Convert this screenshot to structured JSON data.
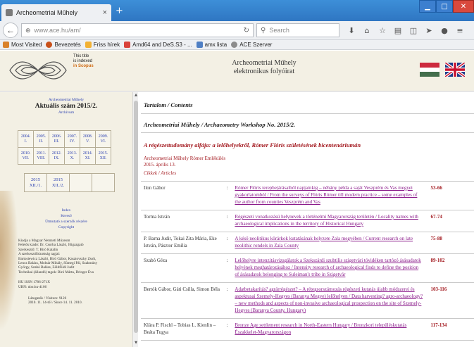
{
  "browser": {
    "tab_title": "Archeometriai Műhely",
    "tab_close": "×",
    "new_tab": "+",
    "url": "www.ace.hu/am/",
    "search_placeholder": "Search",
    "bookmarks": [
      {
        "label": "Most Visited",
        "color": "#d9822b"
      },
      {
        "label": "Bevezetés",
        "color": "#c8501a"
      },
      {
        "label": "Friss hírek",
        "color": "#f2b134"
      },
      {
        "label": "Amd64 and DeS.S3 - ...",
        "color": "#d9433c"
      },
      {
        "label": "amx lista",
        "color": "#4f7fc4"
      },
      {
        "label": "ACE Szerver",
        "color": "#8c8c8c"
      }
    ]
  },
  "header": {
    "indexed_lines": [
      "This title",
      "is indexed",
      "in Scopus"
    ],
    "title_line1": "Archeometriai Műhely",
    "title_line2": "elektronikus folyóirat"
  },
  "sidebar": {
    "top_link": "Archeometriai Műhely",
    "aktualis": "Aktuális szám 2015/2.",
    "archivum": "Archívum",
    "years_row1": [
      [
        "2004.",
        "I."
      ],
      [
        "2005.",
        "II."
      ],
      [
        "2006.",
        "III."
      ],
      [
        "2007.",
        "IV."
      ],
      [
        "2008.",
        "V."
      ],
      [
        "2009.",
        "VI."
      ]
    ],
    "years_row2": [
      [
        "2010.",
        "VII."
      ],
      [
        "2011.",
        "VIII."
      ],
      [
        "2012.",
        "IX."
      ],
      [
        "2013.",
        "X."
      ],
      [
        "2014.",
        "XI."
      ],
      [
        "2015.",
        "XII."
      ]
    ],
    "issues": [
      [
        "2015",
        "XII./1."
      ],
      [
        "2015",
        "XII./2."
      ],
      [
        "",
        ""
      ],
      [
        "",
        ""
      ]
    ],
    "links": [
      "Index",
      "Kereső",
      "Útmutató a szerzők részére",
      "Copyright"
    ],
    "info_lines": [
      "Kiadja a Magyar Nemzeti Múzeum",
      "Felelős kiadó: Dr. Csorba László, főigazgató",
      "Szerkesztő: T. Biró Katalin",
      "A szerkesztőbizottság tagjai:",
      "Bartosiewicz László, Biró Gábor, Kasztovszky Zsolt,",
      "Lencz Balázs, Molnár Mihály, Sümegi Pál, Szakmány",
      "György, Szabó Balázs, Zöldföldi Judit",
      "Technikai (állandó) tagok: Biró Márta, Dringer Éva"
    ],
    "issn_lines": [
      "HU ISSN 1786-271X",
      "URN: nbn:hu-4106"
    ],
    "visits_lines": [
      "Látogatók / Visitors: 9126",
      "2010. 11. 14-től / Since 14. 11. 2010."
    ]
  },
  "main": {
    "contents_heading": "Tartalom / Contents",
    "workshop": "Archeometriai Műhely / Archaeometry Workshop No. 2015/2.",
    "feature_title": "A régészettudomány alfája: a lelőhelyekről, Rómer Flóris születésének bicentenáriumán",
    "feature_by_1": "Archeometriai Műhely Rómer Emlékülés",
    "feature_by_2": "2015. április 13.",
    "section": "Cikkek / Articles",
    "articles": [
      {
        "author": "Ilon Gábor",
        "sep": ":",
        "title": "Rómer Flóris terepbejárásaiból napjainkig – néhány példa a saját Veszprém és Vas megyei gyakorlatomból / From the surveys of Flóris Rómer till modern practice – some examples of the author from counties Veszprém and Vas",
        "pages": "53-66"
      },
      {
        "author": "Torma István",
        "sep": ":",
        "title": "Régészeti vonatkozású helynevek a történelmi Magyarország területén / Locality names with archaeological implications in the territory of Historical Hungary",
        "pages": "67-74"
      },
      {
        "author": "P. Barna Judit, Tokai Zita Mária, Eke István, Pásztor Emília",
        "sep": ":",
        "title": "A késő neolitikus körárkok kutatásának helyzete Zala megyében / Current research on late neolithic rondels in Zala County",
        "pages": "75-88"
      },
      {
        "author": "Szabó Géza",
        "sep": ":",
        "title": "Lelőhelyre intenzitásvizsgálatok a Szekszárdi szubtilis szigetvári tóvidéken tartózó ásásadatok helyének meghatározásához / Intensity research of archaeological finds to define the position of ásásadatok belonging to Suleiman's tribe in Szigetvár",
        "pages": "89-102"
      },
      {
        "author": "Bertók Gábor, Gáti Csilla, Simon Béla",
        "sep": ":",
        "title": "Adatbetakarítás? agrárrégészet? – A rétegsorszámozás régészeti kutatás újabb módszerei és aspektusai Szemely-Hegyes (Baranya Megye) lelőhelyen / Data harvesting? agro-archaeology? – new methods and aspects of non-invasive archaeological prospection on the site of Szemely-Hegyes (Baranya County, Hungary)",
        "pages": "103-116"
      },
      {
        "author": "Klára P. Fischl – Tobias L. Kienlin – Beáta Tugya",
        "sep": ":",
        "title": "Bronze Age settlement research in North-Eastern Hungary / Bronzkori településkutatás Északkelet-Magyarországon",
        "pages": "117-134"
      }
    ]
  },
  "colors": {
    "accent_red": "#a3191f",
    "link_purple": "#8a1a8a",
    "link_blue": "#2a3fb0",
    "panel_bg": "#f3f0e4"
  }
}
